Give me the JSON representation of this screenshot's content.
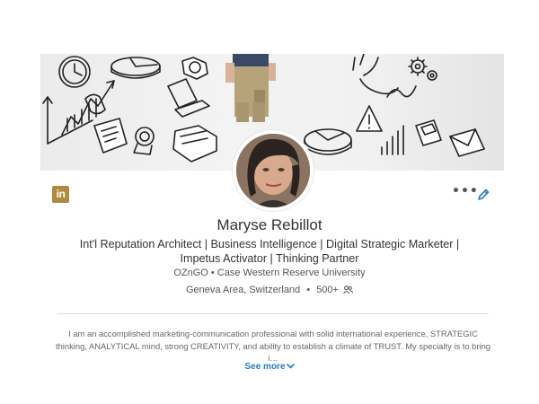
{
  "profile": {
    "name": "Maryse Rebillot",
    "headline": "Int'l Reputation Architect | Business Intelligence | Digital Strategic Marketer | Impetus Activator | Thinking Partner",
    "company": "OZnGO",
    "school": "Case Western Reserve University",
    "location": "Geneva Area, Switzerland",
    "connections": "500+",
    "summary": "I am an accomplished marketing-communication professional with solid international experience, STRATEGIC thinking, ANALYTICAL mind, strong CREATIVITY, and ability to establish a climate of TRUST. My specialty is to bring i…",
    "see_more_label": "See more",
    "separator": "•"
  },
  "brand": {
    "logo_text": "in",
    "logo_color": "#b08a3e",
    "link_color": "#2a7bc0"
  },
  "actions": {
    "more_label": "•••"
  },
  "icons": {
    "logo": "linkedin-logo-icon",
    "edit": "pencil-edit-icon",
    "more": "more-options-icon",
    "connections": "people-icon",
    "expand": "chevron-down-icon"
  }
}
